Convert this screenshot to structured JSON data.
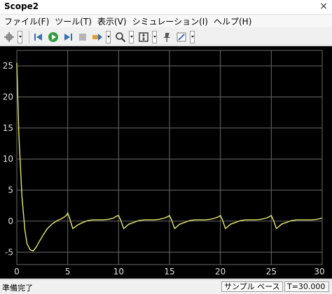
{
  "window": {
    "title": "Scope2",
    "close_glyph": "×"
  },
  "menu": {
    "items": [
      {
        "label": "ファイル(F)"
      },
      {
        "label": "ツール(T)"
      },
      {
        "label": "表示(V)"
      },
      {
        "label": "シミュレーション(I)"
      },
      {
        "label": "ヘルプ(H)"
      }
    ]
  },
  "toolbar": {
    "icons": [
      "gear-icon",
      "step-back-icon",
      "run-icon",
      "step-forward-icon",
      "stop-icon",
      "highlight-icon",
      "zoom-icon",
      "autoscale-icon",
      "pin-icon",
      "edit-icon"
    ]
  },
  "status": {
    "left": "準備完了",
    "mode": "サンプル ベース",
    "time": "T=30.000"
  },
  "colors": {
    "trace": "#e8e86a",
    "grid": "#6a6a6a",
    "background": "#000000",
    "tick_text": "#e0e0e0"
  },
  "chart_data": {
    "type": "line",
    "title": "",
    "xlabel": "",
    "ylabel": "",
    "xlim": [
      0,
      30
    ],
    "ylim": [
      -7,
      27.5
    ],
    "xticks": [
      0,
      5,
      10,
      15,
      20,
      25,
      30
    ],
    "yticks": [
      -5,
      0,
      5,
      10,
      15,
      20,
      25
    ],
    "grid": true,
    "series": [
      {
        "x": [
          0,
          0.2,
          0.5,
          0.8,
          1.0,
          1.3,
          1.6,
          1.9,
          2.2,
          2.6,
          3.0,
          3.5,
          4.0,
          4.4,
          4.7,
          4.9,
          5.0,
          5.2,
          5.5,
          6.0,
          6.5,
          7.0,
          7.5,
          8.0,
          8.5,
          9.0,
          9.5,
          9.8,
          10.0,
          10.2,
          10.5,
          11.0,
          11.5,
          12.0,
          12.5,
          13.0,
          13.5,
          14.0,
          14.5,
          14.8,
          15.0,
          15.2,
          15.5,
          16.0,
          16.5,
          17.0,
          17.5,
          18.0,
          18.5,
          19.0,
          19.5,
          19.8,
          20.0,
          20.2,
          20.5,
          21.0,
          21.5,
          22.0,
          22.5,
          23.0,
          23.5,
          24.0,
          24.5,
          24.8,
          25.0,
          25.2,
          25.5,
          26.0,
          26.5,
          27.0,
          27.5,
          28.0,
          28.5,
          29.0,
          29.5,
          30.0
        ],
        "y": [
          25.5,
          14,
          4,
          -1.5,
          -3.6,
          -4.6,
          -4.8,
          -4.2,
          -3.3,
          -2.2,
          -1.2,
          -0.4,
          0.1,
          0.4,
          0.7,
          1.0,
          1.3,
          0.4,
          -1.2,
          -0.6,
          -0.2,
          0.1,
          0.2,
          0.2,
          0.2,
          0.3,
          0.5,
          0.8,
          0.9,
          0.2,
          -1.2,
          -0.5,
          -0.2,
          0.1,
          0.2,
          0.2,
          0.2,
          0.3,
          0.5,
          0.7,
          0.9,
          0.2,
          -1.2,
          -0.5,
          -0.2,
          0.1,
          0.2,
          0.2,
          0.2,
          0.3,
          0.5,
          0.7,
          0.9,
          0.2,
          -1.2,
          -0.5,
          -0.2,
          0.1,
          0.2,
          0.2,
          0.2,
          0.3,
          0.5,
          0.7,
          0.9,
          0.2,
          -1.2,
          -0.5,
          -0.2,
          0.1,
          0.2,
          0.2,
          0.2,
          0.2,
          0.3,
          0.5
        ]
      }
    ]
  }
}
